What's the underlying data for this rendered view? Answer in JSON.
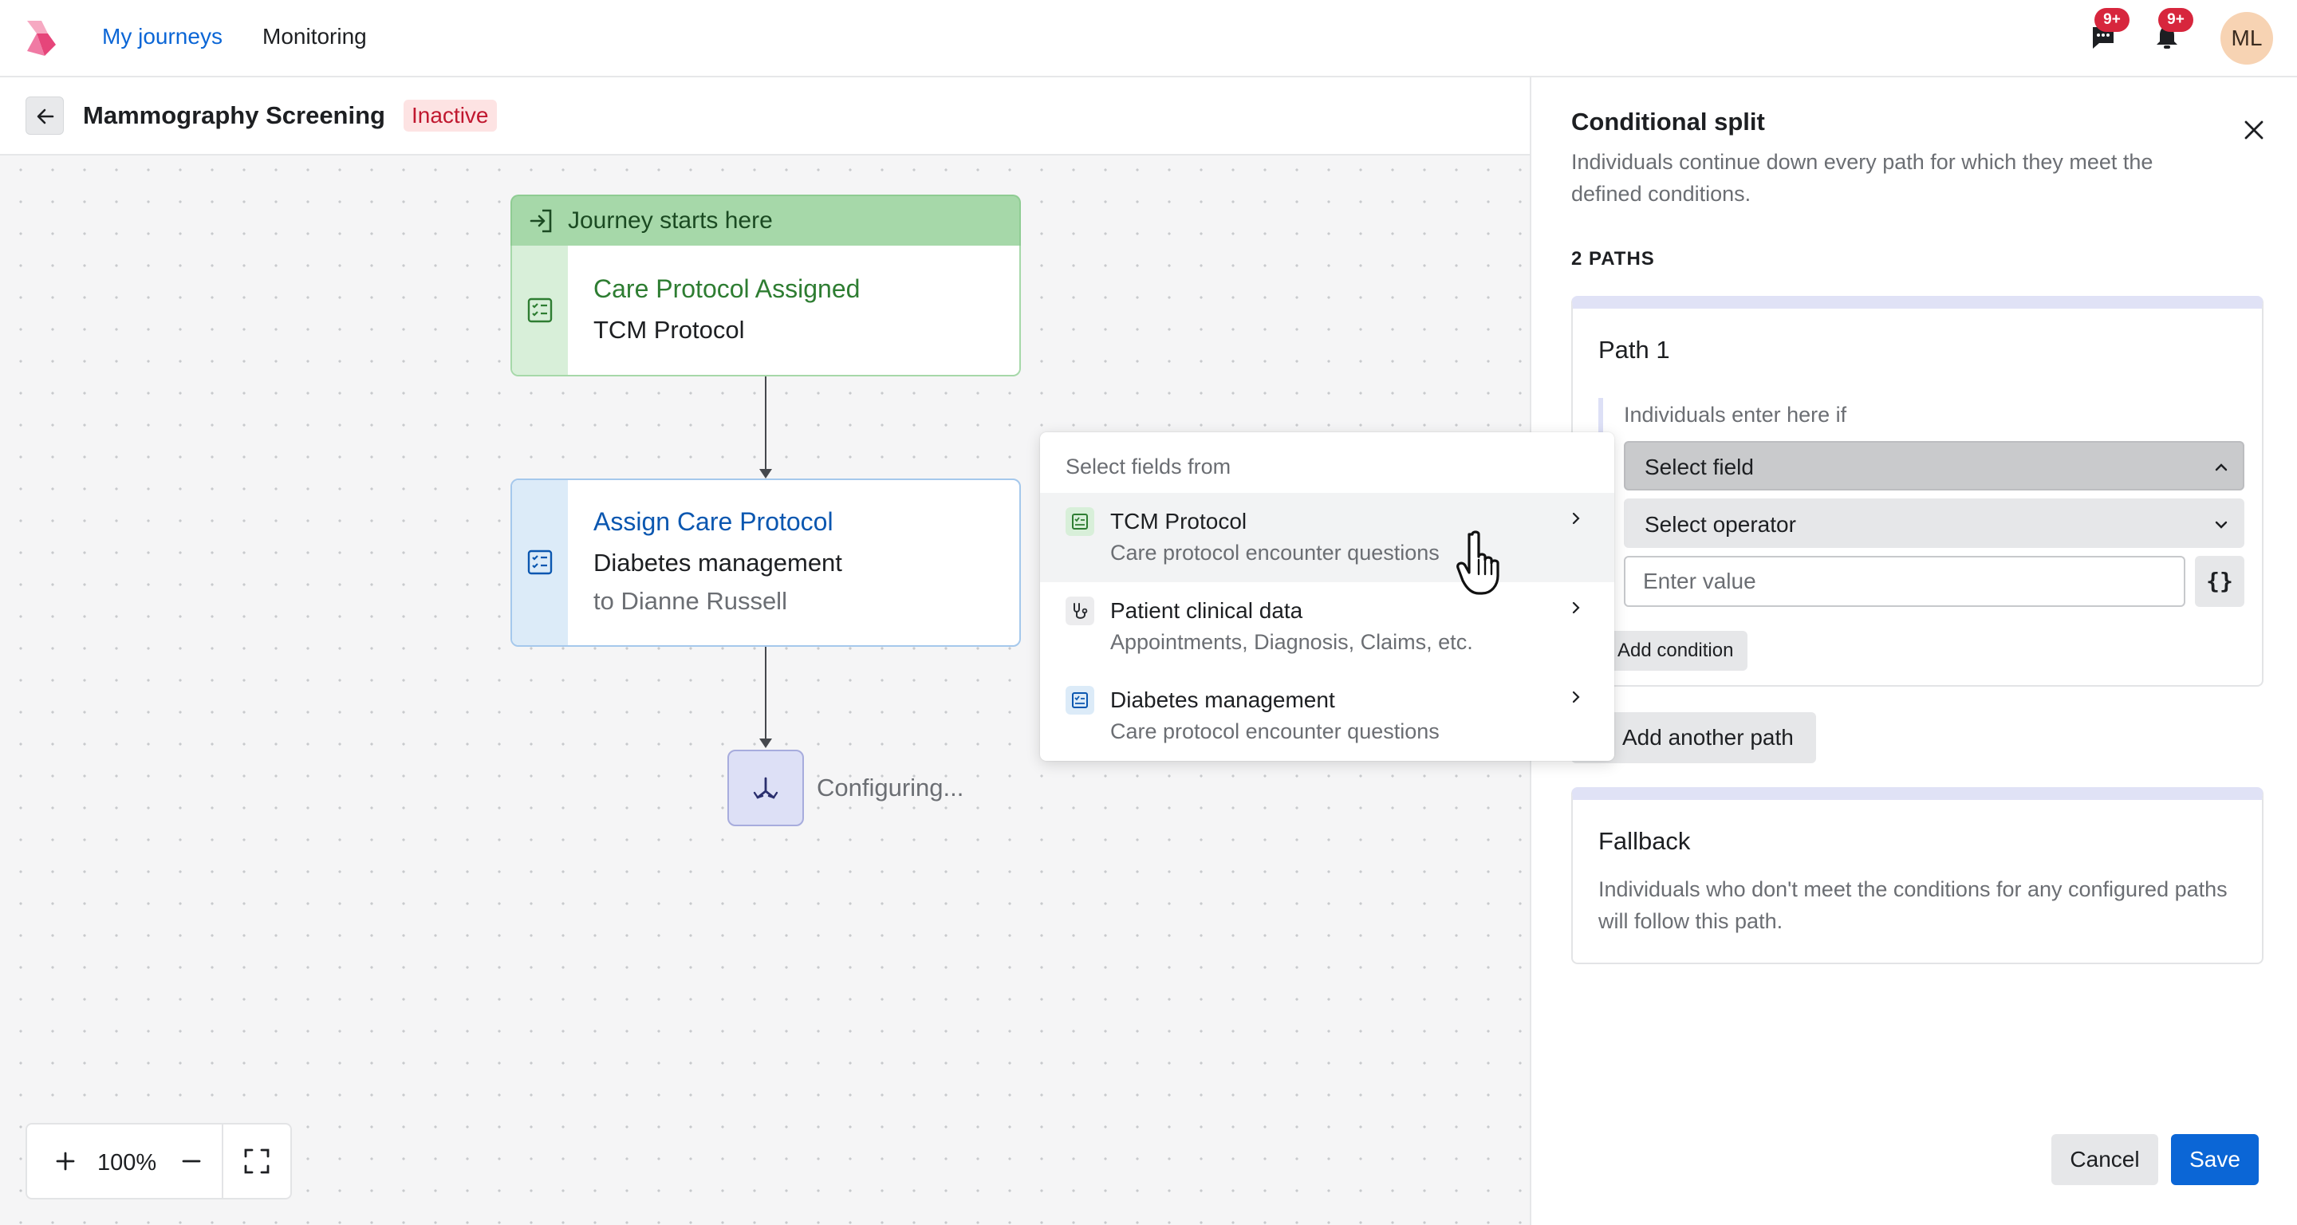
{
  "topnav": {
    "tabs": [
      {
        "label": "My journeys",
        "active": true
      },
      {
        "label": "Monitoring",
        "active": false
      }
    ],
    "messages_badge": "9+",
    "notifications_badge": "9+",
    "avatar_initials": "ML",
    "icons": [
      "app-logo",
      "chat-icon",
      "bell-icon"
    ]
  },
  "canvas": {
    "journey_title": "Mammography Screening",
    "status": "Inactive",
    "start_node": {
      "header": "Journey starts here",
      "title": "Care Protocol Assigned",
      "subtitle": "TCM Protocol"
    },
    "action_node": {
      "title": "Assign Care Protocol",
      "subtitle": "Diabetes management",
      "detail": "to Dianne Russell"
    },
    "split_node": {
      "status": "Configuring..."
    },
    "zoom": {
      "level": "100%"
    }
  },
  "dropdown": {
    "heading": "Select fields from",
    "items": [
      {
        "label": "TCM Protocol",
        "sub": "Care protocol encounter questions",
        "icon": "protocol-icon",
        "hovered": true
      },
      {
        "label": "Patient clinical data",
        "sub": "Appointments, Diagnosis, Claims, etc.",
        "icon": "stethoscope-icon",
        "hovered": false
      },
      {
        "label": "Diabetes management",
        "sub": "Care protocol encounter questions",
        "icon": "protocol-icon",
        "hovered": false
      }
    ]
  },
  "panel": {
    "title": "Conditional split",
    "description": "Individuals continue down every path for which they meet the defined conditions.",
    "paths_count": "2 PATHS",
    "path1": {
      "title": "Path 1",
      "enter_if": "Individuals enter here if",
      "select_field": "Select field",
      "select_operator": "Select operator",
      "value_placeholder": "Enter value",
      "braces": "{}",
      "add_condition": "Add condition"
    },
    "add_path": "Add another path",
    "fallback": {
      "title": "Fallback",
      "description": "Individuals who don't meet the conditions for any configured paths will follow this path."
    },
    "cancel": "Cancel",
    "save": "Save"
  },
  "colors": {
    "accent": "#0b66d6",
    "start_green": "#a6d8a9",
    "action_blue": "#a5c8ec",
    "split_purple": "#dde0f6",
    "status_red": "#c0182f"
  }
}
